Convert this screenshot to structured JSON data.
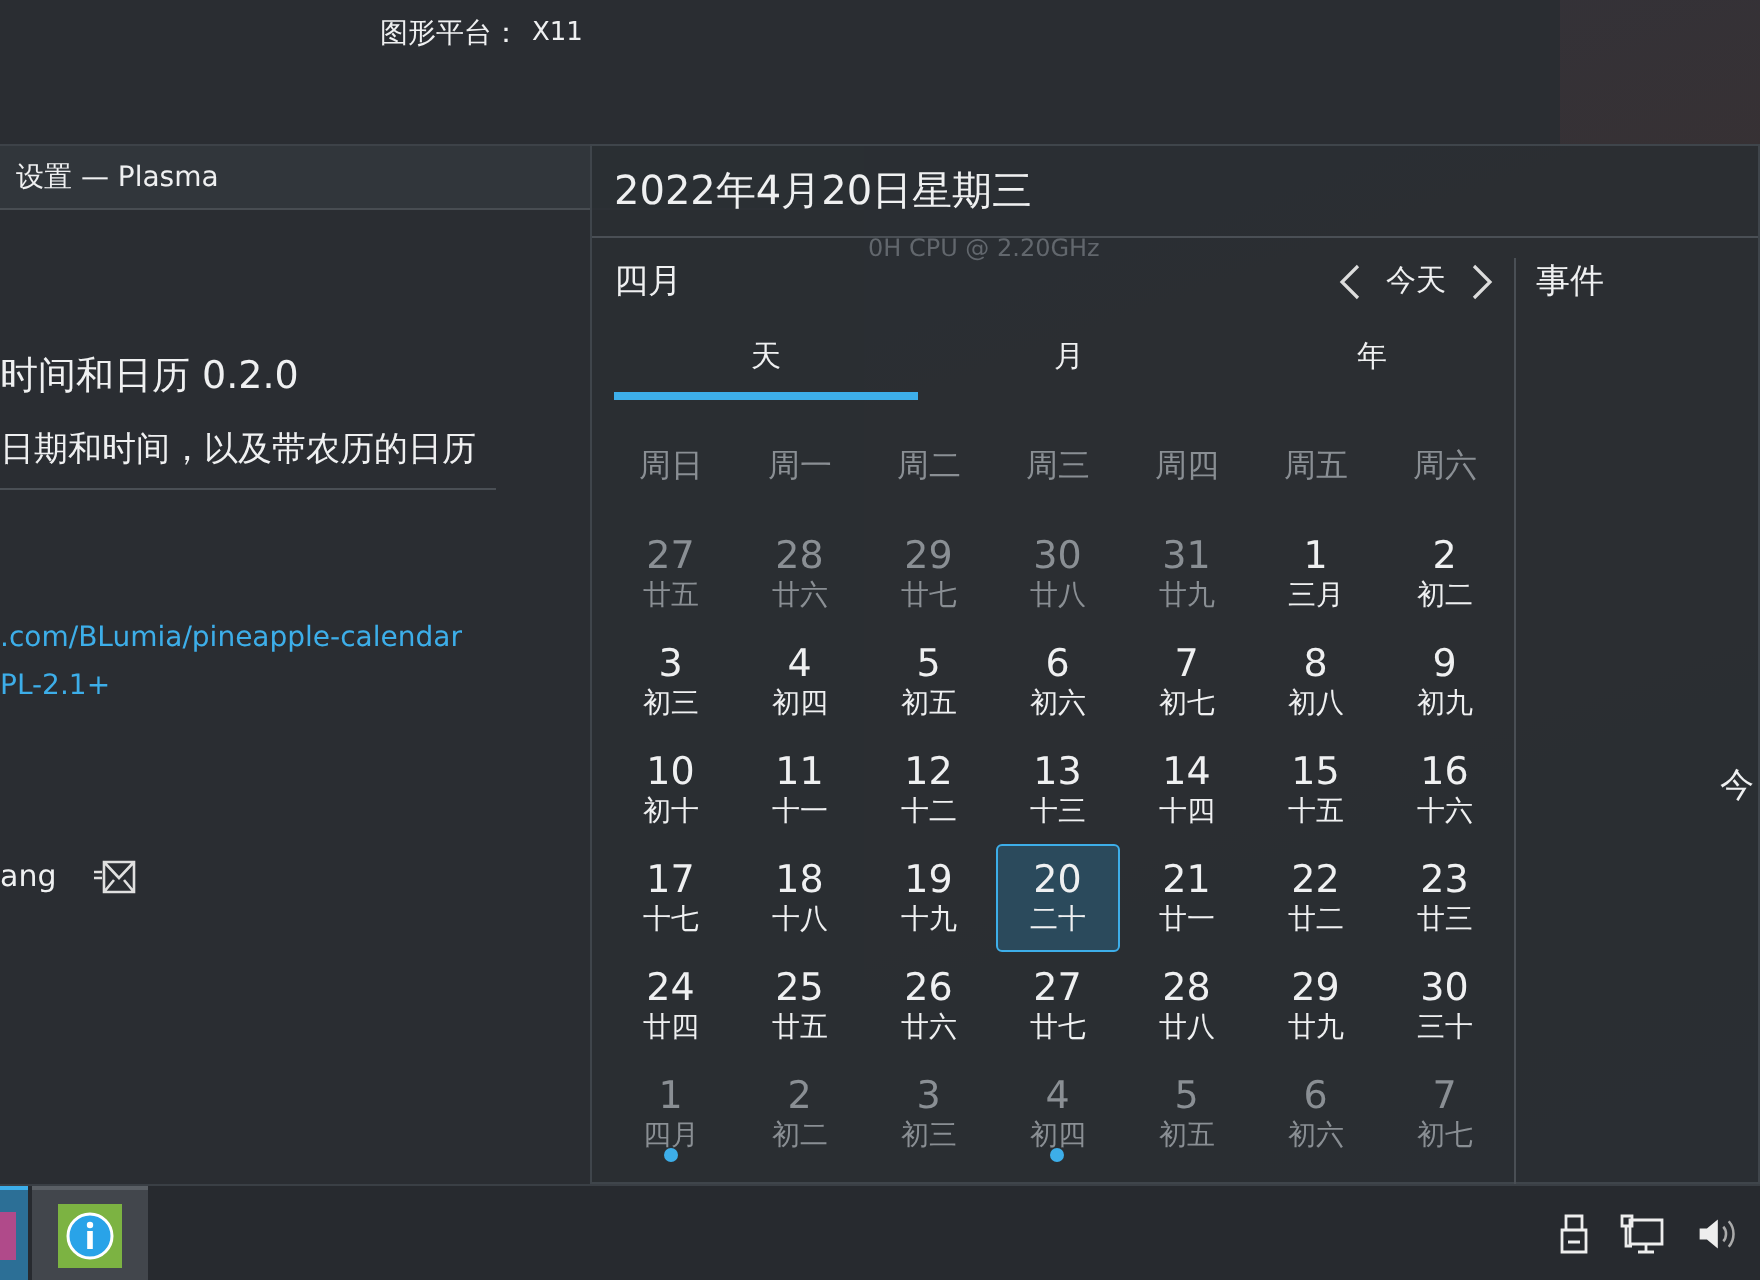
{
  "background_window": {
    "label": "图形平台：",
    "value": "X11",
    "faint_text": "0H CPU @ 2.20GHz"
  },
  "settings_window": {
    "title": "设置 — Plasma",
    "heading": "时间和日历 0.2.0",
    "description": "日期和时间，以及带农历的日历",
    "links": [
      ".com/BLumia/pineapple-calendar",
      "PL-2.1+"
    ],
    "author": "ang"
  },
  "calendar": {
    "date_title": "2022年4月20日星期三",
    "month": "四月",
    "today_button": "今天",
    "tabs": [
      {
        "label": "天",
        "selected": true
      },
      {
        "label": "月",
        "selected": false
      },
      {
        "label": "年",
        "selected": false
      }
    ],
    "weekdays": [
      "周日",
      "周一",
      "周二",
      "周三",
      "周四",
      "周五",
      "周六"
    ],
    "weeks": [
      [
        {
          "day": "27",
          "lunar": "廿五",
          "in_month": false,
          "today": false,
          "event": false
        },
        {
          "day": "28",
          "lunar": "廿六",
          "in_month": false,
          "today": false,
          "event": false
        },
        {
          "day": "29",
          "lunar": "廿七",
          "in_month": false,
          "today": false,
          "event": false
        },
        {
          "day": "30",
          "lunar": "廿八",
          "in_month": false,
          "today": false,
          "event": false
        },
        {
          "day": "31",
          "lunar": "廿九",
          "in_month": false,
          "today": false,
          "event": false
        },
        {
          "day": "1",
          "lunar": "三月",
          "in_month": true,
          "today": false,
          "event": false
        },
        {
          "day": "2",
          "lunar": "初二",
          "in_month": true,
          "today": false,
          "event": false
        }
      ],
      [
        {
          "day": "3",
          "lunar": "初三",
          "in_month": true,
          "today": false,
          "event": false
        },
        {
          "day": "4",
          "lunar": "初四",
          "in_month": true,
          "today": false,
          "event": false
        },
        {
          "day": "5",
          "lunar": "初五",
          "in_month": true,
          "today": false,
          "event": false
        },
        {
          "day": "6",
          "lunar": "初六",
          "in_month": true,
          "today": false,
          "event": false
        },
        {
          "day": "7",
          "lunar": "初七",
          "in_month": true,
          "today": false,
          "event": false
        },
        {
          "day": "8",
          "lunar": "初八",
          "in_month": true,
          "today": false,
          "event": false
        },
        {
          "day": "9",
          "lunar": "初九",
          "in_month": true,
          "today": false,
          "event": false
        }
      ],
      [
        {
          "day": "10",
          "lunar": "初十",
          "in_month": true,
          "today": false,
          "event": false
        },
        {
          "day": "11",
          "lunar": "十一",
          "in_month": true,
          "today": false,
          "event": false
        },
        {
          "day": "12",
          "lunar": "十二",
          "in_month": true,
          "today": false,
          "event": false
        },
        {
          "day": "13",
          "lunar": "十三",
          "in_month": true,
          "today": false,
          "event": false
        },
        {
          "day": "14",
          "lunar": "十四",
          "in_month": true,
          "today": false,
          "event": false
        },
        {
          "day": "15",
          "lunar": "十五",
          "in_month": true,
          "today": false,
          "event": false
        },
        {
          "day": "16",
          "lunar": "十六",
          "in_month": true,
          "today": false,
          "event": false
        }
      ],
      [
        {
          "day": "17",
          "lunar": "十七",
          "in_month": true,
          "today": false,
          "event": false
        },
        {
          "day": "18",
          "lunar": "十八",
          "in_month": true,
          "today": false,
          "event": false
        },
        {
          "day": "19",
          "lunar": "十九",
          "in_month": true,
          "today": false,
          "event": false
        },
        {
          "day": "20",
          "lunar": "二十",
          "in_month": true,
          "today": true,
          "event": false
        },
        {
          "day": "21",
          "lunar": "廿一",
          "in_month": true,
          "today": false,
          "event": false
        },
        {
          "day": "22",
          "lunar": "廿二",
          "in_month": true,
          "today": false,
          "event": false
        },
        {
          "day": "23",
          "lunar": "廿三",
          "in_month": true,
          "today": false,
          "event": false
        }
      ],
      [
        {
          "day": "24",
          "lunar": "廿四",
          "in_month": true,
          "today": false,
          "event": false
        },
        {
          "day": "25",
          "lunar": "廿五",
          "in_month": true,
          "today": false,
          "event": false
        },
        {
          "day": "26",
          "lunar": "廿六",
          "in_month": true,
          "today": false,
          "event": false
        },
        {
          "day": "27",
          "lunar": "廿七",
          "in_month": true,
          "today": false,
          "event": false
        },
        {
          "day": "28",
          "lunar": "廿八",
          "in_month": true,
          "today": false,
          "event": false
        },
        {
          "day": "29",
          "lunar": "廿九",
          "in_month": true,
          "today": false,
          "event": false
        },
        {
          "day": "30",
          "lunar": "三十",
          "in_month": true,
          "today": false,
          "event": false
        }
      ],
      [
        {
          "day": "1",
          "lunar": "四月",
          "in_month": false,
          "today": false,
          "event": true
        },
        {
          "day": "2",
          "lunar": "初二",
          "in_month": false,
          "today": false,
          "event": false
        },
        {
          "day": "3",
          "lunar": "初三",
          "in_month": false,
          "today": false,
          "event": false
        },
        {
          "day": "4",
          "lunar": "初四",
          "in_month": false,
          "today": false,
          "event": true
        },
        {
          "day": "5",
          "lunar": "初五",
          "in_month": false,
          "today": false,
          "event": false
        },
        {
          "day": "6",
          "lunar": "初六",
          "in_month": false,
          "today": false,
          "event": false
        },
        {
          "day": "7",
          "lunar": "初七",
          "in_month": false,
          "today": false,
          "event": false
        }
      ]
    ],
    "events_title": "事件",
    "events_partial": "今"
  },
  "taskbar": {
    "tasks": [
      {
        "kind": "app",
        "selected": true
      },
      {
        "kind": "info",
        "selected": false
      }
    ]
  }
}
